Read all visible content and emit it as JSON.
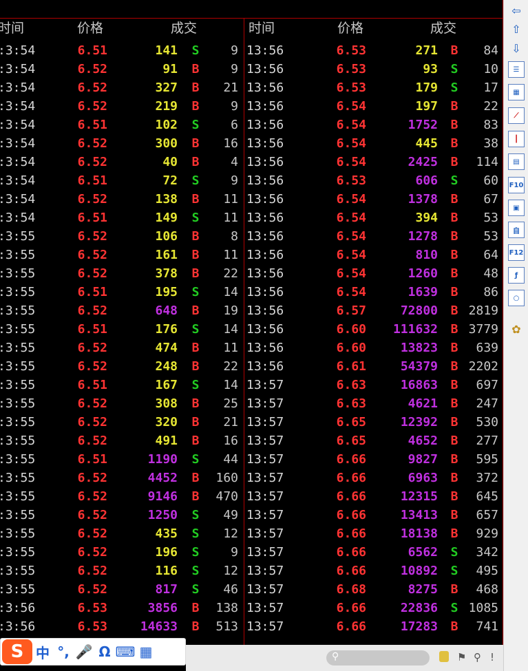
{
  "headers": {
    "left": {
      "time": "时间",
      "price": "价格",
      "volume": "成交"
    },
    "right": {
      "time": "时间",
      "price": "价格",
      "volume": "成交"
    }
  },
  "left_trades": [
    {
      "time": ":3:54",
      "price": "6.51",
      "volume": "141",
      "dir": "S",
      "count": "9",
      "vcolor": "yellow"
    },
    {
      "time": ":3:54",
      "price": "6.52",
      "volume": "91",
      "dir": "B",
      "count": "9",
      "vcolor": "yellow"
    },
    {
      "time": ":3:54",
      "price": "6.52",
      "volume": "327",
      "dir": "B",
      "count": "21",
      "vcolor": "yellow"
    },
    {
      "time": ":3:54",
      "price": "6.52",
      "volume": "219",
      "dir": "B",
      "count": "9",
      "vcolor": "yellow"
    },
    {
      "time": ":3:54",
      "price": "6.51",
      "volume": "102",
      "dir": "S",
      "count": "6",
      "vcolor": "yellow"
    },
    {
      "time": ":3:54",
      "price": "6.52",
      "volume": "300",
      "dir": "B",
      "count": "16",
      "vcolor": "yellow"
    },
    {
      "time": ":3:54",
      "price": "6.52",
      "volume": "40",
      "dir": "B",
      "count": "4",
      "vcolor": "yellow"
    },
    {
      "time": ":3:54",
      "price": "6.51",
      "volume": "72",
      "dir": "S",
      "count": "9",
      "vcolor": "yellow"
    },
    {
      "time": ":3:54",
      "price": "6.52",
      "volume": "138",
      "dir": "B",
      "count": "11",
      "vcolor": "yellow"
    },
    {
      "time": ":3:54",
      "price": "6.51",
      "volume": "149",
      "dir": "S",
      "count": "11",
      "vcolor": "yellow"
    },
    {
      "time": ":3:55",
      "price": "6.52",
      "volume": "106",
      "dir": "B",
      "count": "8",
      "vcolor": "yellow"
    },
    {
      "time": ":3:55",
      "price": "6.52",
      "volume": "161",
      "dir": "B",
      "count": "11",
      "vcolor": "yellow"
    },
    {
      "time": ":3:55",
      "price": "6.52",
      "volume": "378",
      "dir": "B",
      "count": "22",
      "vcolor": "yellow"
    },
    {
      "time": ":3:55",
      "price": "6.51",
      "volume": "195",
      "dir": "S",
      "count": "14",
      "vcolor": "yellow"
    },
    {
      "time": ":3:55",
      "price": "6.52",
      "volume": "648",
      "dir": "B",
      "count": "19",
      "vcolor": "magenta"
    },
    {
      "time": ":3:55",
      "price": "6.51",
      "volume": "176",
      "dir": "S",
      "count": "14",
      "vcolor": "yellow"
    },
    {
      "time": ":3:55",
      "price": "6.52",
      "volume": "474",
      "dir": "B",
      "count": "11",
      "vcolor": "yellow"
    },
    {
      "time": ":3:55",
      "price": "6.52",
      "volume": "248",
      "dir": "B",
      "count": "22",
      "vcolor": "yellow"
    },
    {
      "time": ":3:55",
      "price": "6.51",
      "volume": "167",
      "dir": "S",
      "count": "14",
      "vcolor": "yellow"
    },
    {
      "time": ":3:55",
      "price": "6.52",
      "volume": "308",
      "dir": "B",
      "count": "25",
      "vcolor": "yellow"
    },
    {
      "time": ":3:55",
      "price": "6.52",
      "volume": "320",
      "dir": "B",
      "count": "21",
      "vcolor": "yellow"
    },
    {
      "time": ":3:55",
      "price": "6.52",
      "volume": "491",
      "dir": "B",
      "count": "16",
      "vcolor": "yellow"
    },
    {
      "time": ":3:55",
      "price": "6.51",
      "volume": "1190",
      "dir": "S",
      "count": "44",
      "vcolor": "magenta"
    },
    {
      "time": ":3:55",
      "price": "6.52",
      "volume": "4452",
      "dir": "B",
      "count": "160",
      "vcolor": "magenta"
    },
    {
      "time": ":3:55",
      "price": "6.52",
      "volume": "9146",
      "dir": "B",
      "count": "470",
      "vcolor": "magenta"
    },
    {
      "time": ":3:55",
      "price": "6.52",
      "volume": "1250",
      "dir": "S",
      "count": "49",
      "vcolor": "magenta"
    },
    {
      "time": ":3:55",
      "price": "6.52",
      "volume": "435",
      "dir": "S",
      "count": "12",
      "vcolor": "yellow"
    },
    {
      "time": ":3:55",
      "price": "6.52",
      "volume": "196",
      "dir": "S",
      "count": "9",
      "vcolor": "yellow"
    },
    {
      "time": ":3:55",
      "price": "6.52",
      "volume": "116",
      "dir": "S",
      "count": "12",
      "vcolor": "yellow"
    },
    {
      "time": ":3:55",
      "price": "6.52",
      "volume": "817",
      "dir": "S",
      "count": "46",
      "vcolor": "magenta"
    },
    {
      "time": ":3:56",
      "price": "6.53",
      "volume": "3856",
      "dir": "B",
      "count": "138",
      "vcolor": "magenta"
    },
    {
      "time": ":3:56",
      "price": "6.53",
      "volume": "14633",
      "dir": "B",
      "count": "513",
      "vcolor": "magenta"
    }
  ],
  "right_trades": [
    {
      "time": "13:56",
      "price": "6.53",
      "volume": "271",
      "dir": "B",
      "count": "84",
      "vcolor": "yellow"
    },
    {
      "time": "13:56",
      "price": "6.53",
      "volume": "93",
      "dir": "S",
      "count": "10",
      "vcolor": "yellow"
    },
    {
      "time": "13:56",
      "price": "6.53",
      "volume": "179",
      "dir": "S",
      "count": "17",
      "vcolor": "yellow"
    },
    {
      "time": "13:56",
      "price": "6.54",
      "volume": "197",
      "dir": "B",
      "count": "22",
      "vcolor": "yellow"
    },
    {
      "time": "13:56",
      "price": "6.54",
      "volume": "1752",
      "dir": "B",
      "count": "83",
      "vcolor": "magenta"
    },
    {
      "time": "13:56",
      "price": "6.54",
      "volume": "445",
      "dir": "B",
      "count": "38",
      "vcolor": "yellow"
    },
    {
      "time": "13:56",
      "price": "6.54",
      "volume": "2425",
      "dir": "B",
      "count": "114",
      "vcolor": "magenta"
    },
    {
      "time": "13:56",
      "price": "6.53",
      "volume": "606",
      "dir": "S",
      "count": "60",
      "vcolor": "magenta"
    },
    {
      "time": "13:56",
      "price": "6.54",
      "volume": "1378",
      "dir": "B",
      "count": "67",
      "vcolor": "magenta"
    },
    {
      "time": "13:56",
      "price": "6.54",
      "volume": "394",
      "dir": "B",
      "count": "53",
      "vcolor": "yellow"
    },
    {
      "time": "13:56",
      "price": "6.54",
      "volume": "1278",
      "dir": "B",
      "count": "53",
      "vcolor": "magenta"
    },
    {
      "time": "13:56",
      "price": "6.54",
      "volume": "810",
      "dir": "B",
      "count": "64",
      "vcolor": "magenta"
    },
    {
      "time": "13:56",
      "price": "6.54",
      "volume": "1260",
      "dir": "B",
      "count": "48",
      "vcolor": "magenta"
    },
    {
      "time": "13:56",
      "price": "6.54",
      "volume": "1639",
      "dir": "B",
      "count": "86",
      "vcolor": "magenta"
    },
    {
      "time": "13:56",
      "price": "6.57",
      "volume": "72800",
      "dir": "B",
      "count": "2819",
      "vcolor": "magenta"
    },
    {
      "time": "13:56",
      "price": "6.60",
      "volume": "111632",
      "dir": "B",
      "count": "3779",
      "vcolor": "magenta"
    },
    {
      "time": "13:56",
      "price": "6.60",
      "volume": "13823",
      "dir": "B",
      "count": "639",
      "vcolor": "magenta"
    },
    {
      "time": "13:56",
      "price": "6.61",
      "volume": "54379",
      "dir": "B",
      "count": "2202",
      "vcolor": "magenta"
    },
    {
      "time": "13:57",
      "price": "6.63",
      "volume": "16863",
      "dir": "B",
      "count": "697",
      "vcolor": "magenta"
    },
    {
      "time": "13:57",
      "price": "6.63",
      "volume": "4621",
      "dir": "B",
      "count": "247",
      "vcolor": "magenta"
    },
    {
      "time": "13:57",
      "price": "6.65",
      "volume": "12392",
      "dir": "B",
      "count": "530",
      "vcolor": "magenta"
    },
    {
      "time": "13:57",
      "price": "6.65",
      "volume": "4652",
      "dir": "B",
      "count": "277",
      "vcolor": "magenta"
    },
    {
      "time": "13:57",
      "price": "6.66",
      "volume": "9827",
      "dir": "B",
      "count": "595",
      "vcolor": "magenta"
    },
    {
      "time": "13:57",
      "price": "6.66",
      "volume": "6963",
      "dir": "B",
      "count": "372",
      "vcolor": "magenta"
    },
    {
      "time": "13:57",
      "price": "6.66",
      "volume": "12315",
      "dir": "B",
      "count": "645",
      "vcolor": "magenta"
    },
    {
      "time": "13:57",
      "price": "6.66",
      "volume": "13413",
      "dir": "B",
      "count": "657",
      "vcolor": "magenta"
    },
    {
      "time": "13:57",
      "price": "6.66",
      "volume": "18138",
      "dir": "B",
      "count": "929",
      "vcolor": "magenta"
    },
    {
      "time": "13:57",
      "price": "6.66",
      "volume": "6562",
      "dir": "S",
      "count": "342",
      "vcolor": "magenta"
    },
    {
      "time": "13:57",
      "price": "6.66",
      "volume": "10892",
      "dir": "S",
      "count": "495",
      "vcolor": "magenta"
    },
    {
      "time": "13:57",
      "price": "6.68",
      "volume": "8275",
      "dir": "B",
      "count": "468",
      "vcolor": "magenta"
    },
    {
      "time": "13:57",
      "price": "6.66",
      "volume": "22836",
      "dir": "S",
      "count": "1085",
      "vcolor": "magenta"
    },
    {
      "time": "13:57",
      "price": "6.66",
      "volume": "17283",
      "dir": "B",
      "count": "741",
      "vcolor": "magenta"
    }
  ],
  "colors": {
    "price": "#ff3333",
    "buy": "#ff3333",
    "sell": "#22cc22",
    "yellow": "#e6e633",
    "magenta": "#c030e0",
    "count": "#c8c8c8",
    "grid": "#b00000"
  },
  "sidebar": {
    "icons": [
      "arrow-left-icon",
      "arrow-up-icon",
      "arrow-down-icon",
      "list-icon",
      "grid-icon",
      "line-chart-icon",
      "candlestick-icon",
      "news-icon",
      "f10-icon",
      "stock-icon",
      "self-select-icon",
      "f12-icon",
      "formula-icon",
      "circle-icon",
      "gear-icon"
    ],
    "f10_label": "F10",
    "f12_label": "F12"
  },
  "ime": {
    "logo": "S",
    "lang": "中",
    "punct": "°,",
    "mic": "🎤",
    "omega": "Ω",
    "keyboard": "⌨",
    "apps": "▦"
  }
}
